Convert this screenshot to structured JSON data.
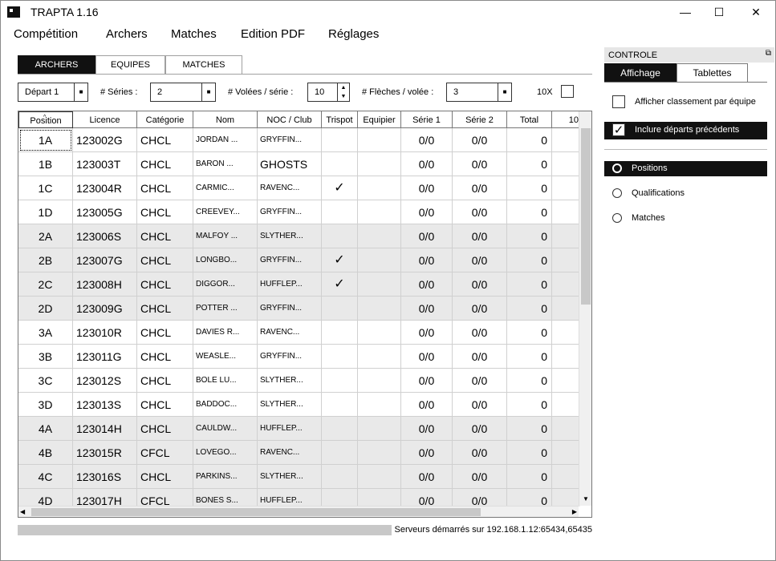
{
  "app": {
    "title": "TRAPTA 1.16"
  },
  "window_controls": {
    "minimize": "—",
    "maximize": "☐",
    "close": "✕"
  },
  "menu": [
    "Compétition",
    "Archers",
    "Matches",
    "Edition PDF",
    "Réglages"
  ],
  "tabs": [
    {
      "label": "ARCHERS",
      "active": true
    },
    {
      "label": "EQUIPES",
      "active": false
    },
    {
      "label": "MATCHES",
      "active": false
    }
  ],
  "toolbar": {
    "depart_value": "Départ 1",
    "series_label": "# Séries :",
    "series_value": "2",
    "volees_label": "# Volées / série :",
    "volees_value": "10",
    "fleches_label": "# Flèches / volée :",
    "fleches_value": "3",
    "tenx_label": "10X",
    "tenx_checked": false
  },
  "table": {
    "columns": [
      "Position",
      "Licence",
      "Catégorie",
      "Nom",
      "NOC / Club",
      "Trispot",
      "Equipier",
      "Série 1",
      "Série 2",
      "Total",
      "10"
    ],
    "rows": [
      {
        "position": "1A",
        "licence": "123002G",
        "categorie": "CHCL",
        "nom": "JORDAN ...",
        "club": "GRYFFIN...",
        "trispot": "",
        "equipier": "",
        "serie1": "0/0",
        "serie2": "0/0",
        "total": "0"
      },
      {
        "position": "1B",
        "licence": "123003T",
        "categorie": "CHCL",
        "nom": "BARON ...",
        "club": "GHOSTS",
        "trispot": "",
        "equipier": "",
        "serie1": "0/0",
        "serie2": "0/0",
        "total": "0"
      },
      {
        "position": "1C",
        "licence": "123004R",
        "categorie": "CHCL",
        "nom": "CARMIC...",
        "club": "RAVENC...",
        "trispot": "✓",
        "equipier": "",
        "serie1": "0/0",
        "serie2": "0/0",
        "total": "0"
      },
      {
        "position": "1D",
        "licence": "123005G",
        "categorie": "CHCL",
        "nom": "CREEVEY...",
        "club": "GRYFFIN...",
        "trispot": "",
        "equipier": "",
        "serie1": "0/0",
        "serie2": "0/0",
        "total": "0"
      },
      {
        "position": "2A",
        "licence": "123006S",
        "categorie": "CHCL",
        "nom": "MALFOY ...",
        "club": "SLYTHER...",
        "trispot": "",
        "equipier": "",
        "serie1": "0/0",
        "serie2": "0/0",
        "total": "0"
      },
      {
        "position": "2B",
        "licence": "123007G",
        "categorie": "CHCL",
        "nom": "LONGBO...",
        "club": "GRYFFIN...",
        "trispot": "✓",
        "equipier": "",
        "serie1": "0/0",
        "serie2": "0/0",
        "total": "0"
      },
      {
        "position": "2C",
        "licence": "123008H",
        "categorie": "CHCL",
        "nom": "DIGGOR...",
        "club": "HUFFLEP...",
        "trispot": "✓",
        "equipier": "",
        "serie1": "0/0",
        "serie2": "0/0",
        "total": "0"
      },
      {
        "position": "2D",
        "licence": "123009G",
        "categorie": "CHCL",
        "nom": "POTTER ...",
        "club": "GRYFFIN...",
        "trispot": "",
        "equipier": "",
        "serie1": "0/0",
        "serie2": "0/0",
        "total": "0"
      },
      {
        "position": "3A",
        "licence": "123010R",
        "categorie": "CHCL",
        "nom": "DAVIES R...",
        "club": "RAVENC...",
        "trispot": "",
        "equipier": "",
        "serie1": "0/0",
        "serie2": "0/0",
        "total": "0"
      },
      {
        "position": "3B",
        "licence": "123011G",
        "categorie": "CHCL",
        "nom": "WEASLE...",
        "club": "GRYFFIN...",
        "trispot": "",
        "equipier": "",
        "serie1": "0/0",
        "serie2": "0/0",
        "total": "0"
      },
      {
        "position": "3C",
        "licence": "123012S",
        "categorie": "CHCL",
        "nom": "BOLE LU...",
        "club": "SLYTHER...",
        "trispot": "",
        "equipier": "",
        "serie1": "0/0",
        "serie2": "0/0",
        "total": "0"
      },
      {
        "position": "3D",
        "licence": "123013S",
        "categorie": "CHCL",
        "nom": "BADDOC...",
        "club": "SLYTHER...",
        "trispot": "",
        "equipier": "",
        "serie1": "0/0",
        "serie2": "0/0",
        "total": "0"
      },
      {
        "position": "4A",
        "licence": "123014H",
        "categorie": "CHCL",
        "nom": "CAULDW...",
        "club": "HUFFLEP...",
        "trispot": "",
        "equipier": "",
        "serie1": "0/0",
        "serie2": "0/0",
        "total": "0"
      },
      {
        "position": "4B",
        "licence": "123015R",
        "categorie": "CFCL",
        "nom": "LOVEGO...",
        "club": "RAVENC...",
        "trispot": "",
        "equipier": "",
        "serie1": "0/0",
        "serie2": "0/0",
        "total": "0"
      },
      {
        "position": "4C",
        "licence": "123016S",
        "categorie": "CHCL",
        "nom": "PARKINS...",
        "club": "SLYTHER...",
        "trispot": "",
        "equipier": "",
        "serie1": "0/0",
        "serie2": "0/0",
        "total": "0"
      },
      {
        "position": "4D",
        "licence": "123017H",
        "categorie": "CFCL",
        "nom": "BONES S...",
        "club": "HUFFLEP...",
        "trispot": "",
        "equipier": "",
        "serie1": "0/0",
        "serie2": "0/0",
        "total": "0"
      }
    ]
  },
  "status": {
    "text": "Serveurs démarrés sur  192.168.1.12:65434,65435"
  },
  "panel": {
    "title": "CONTROLE",
    "tabs": [
      {
        "label": "Affichage",
        "active": true
      },
      {
        "label": "Tablettes",
        "active": false
      }
    ],
    "options": [
      {
        "label": "Afficher classement par équipe",
        "checked": false
      },
      {
        "label": "Inclure départs précédents",
        "checked": true
      }
    ],
    "radios": [
      {
        "label": "Positions",
        "selected": true
      },
      {
        "label": "Qualifications",
        "selected": false
      },
      {
        "label": "Matches",
        "selected": false
      }
    ]
  }
}
